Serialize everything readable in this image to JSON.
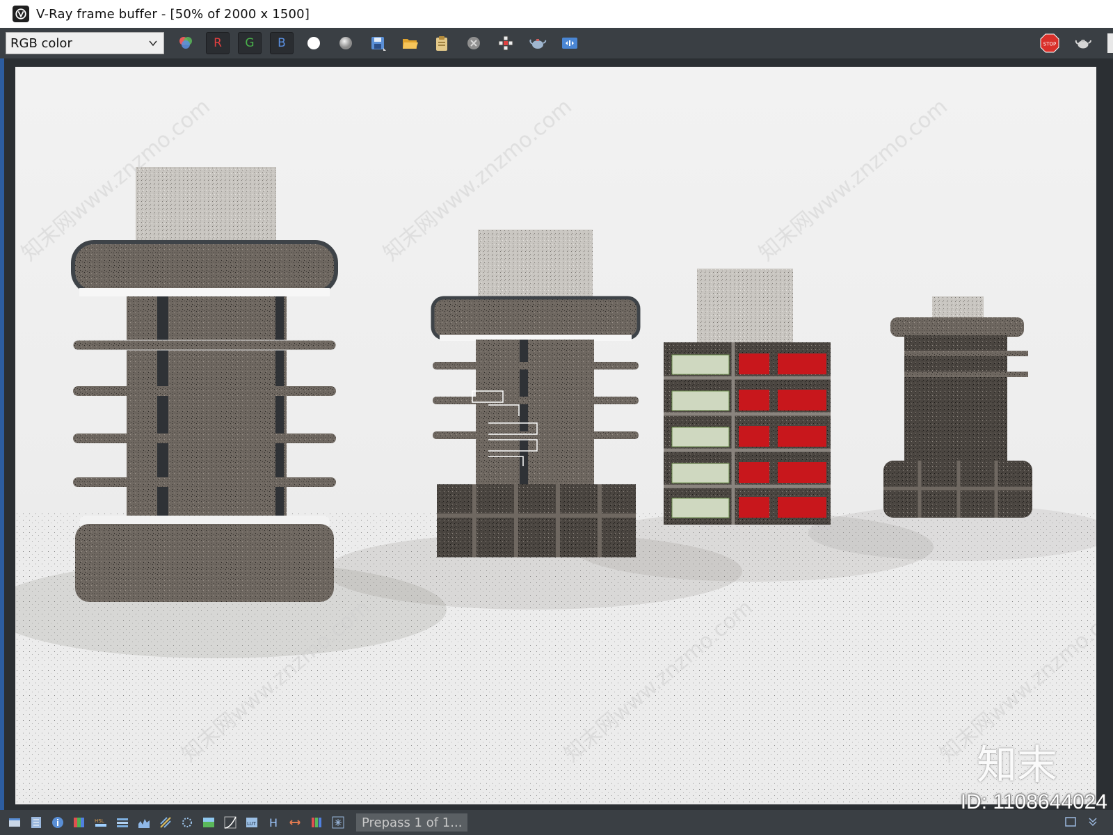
{
  "window": {
    "title": "V-Ray frame buffer - [50% of 2000 x 1500]"
  },
  "toolbar": {
    "channel_select": "RGB color",
    "channel_buttons": [
      "R",
      "G",
      "B"
    ],
    "icons": [
      "color-channels-icon",
      "red-channel",
      "green-channel",
      "blue-channel",
      "white-display-icon",
      "gray-display-icon",
      "save-icon",
      "open-folder-icon",
      "clipboard-icon",
      "clear-icon",
      "region-render-icon",
      "render-teapot-icon",
      "stereo-icon",
      "stop-icon",
      "teapot-render-icon"
    ],
    "colors": {
      "red": "#e04040",
      "green": "#49b04a",
      "blue": "#5a8fe0",
      "stop": "#d9302a"
    }
  },
  "render": {
    "watermark": "知末网www.znzmo.com",
    "brand": "知末",
    "id_label": "ID: 1108644024"
  },
  "statusbar": {
    "channel_letters": [
      "H"
    ],
    "status": "Prepass 1 of 1..."
  }
}
